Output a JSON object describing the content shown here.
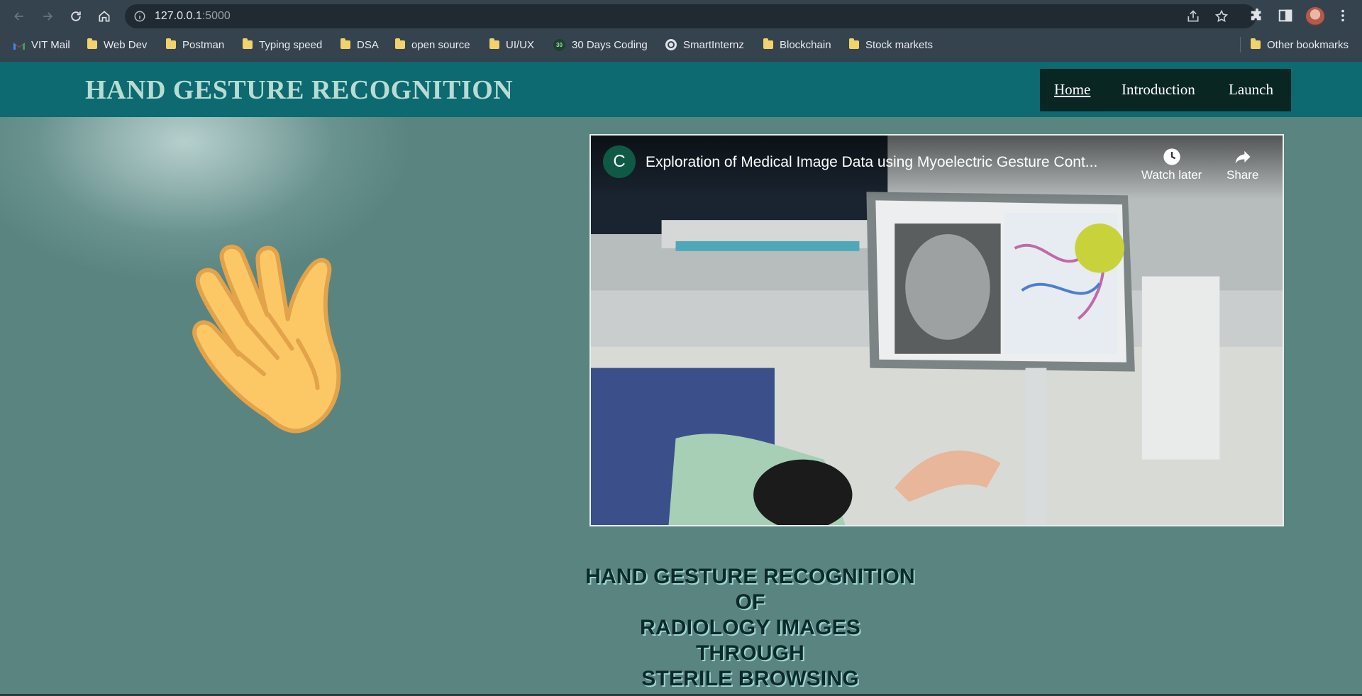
{
  "browser": {
    "url_host": "127.0.0.1",
    "url_port": ":5000",
    "bookmarks": [
      {
        "label": "VIT Mail",
        "icon": "gmail-icon"
      },
      {
        "label": "Web Dev",
        "icon": "folder-icon"
      },
      {
        "label": "Postman",
        "icon": "folder-icon"
      },
      {
        "label": "Typing speed",
        "icon": "folder-icon"
      },
      {
        "label": "DSA",
        "icon": "folder-icon"
      },
      {
        "label": "open source",
        "icon": "folder-icon"
      },
      {
        "label": "UI/UX",
        "icon": "folder-icon"
      },
      {
        "label": "30 Days Coding",
        "icon": "badge-icon"
      },
      {
        "label": "SmartInternz",
        "icon": "globe-icon"
      },
      {
        "label": "Blockchain",
        "icon": "folder-icon"
      },
      {
        "label": "Stock markets",
        "icon": "folder-icon"
      }
    ],
    "other_bookmarks": "Other bookmarks",
    "badge_text": "30"
  },
  "site": {
    "title": "HAND GESTURE RECOGNITION",
    "nav": [
      {
        "label": "Home",
        "active": true
      },
      {
        "label": "Introduction",
        "active": false
      },
      {
        "label": "Launch",
        "active": false
      }
    ]
  },
  "video": {
    "channel_initial": "C",
    "title": "Exploration of Medical Image Data using Myoelectric Gesture Cont...",
    "watch_later": "Watch later",
    "share": "Share"
  },
  "tagline": {
    "lines": [
      "HAND GESTURE RECOGNITION",
      "OF",
      "RADIOLOGY IMAGES",
      "THROUGH",
      "STERILE BROWSING"
    ]
  },
  "colors": {
    "header_bg": "#0c6a70",
    "title_color": "#b8dcd4",
    "nav_bg": "#0a2623",
    "page_bg": "#5a8480"
  }
}
